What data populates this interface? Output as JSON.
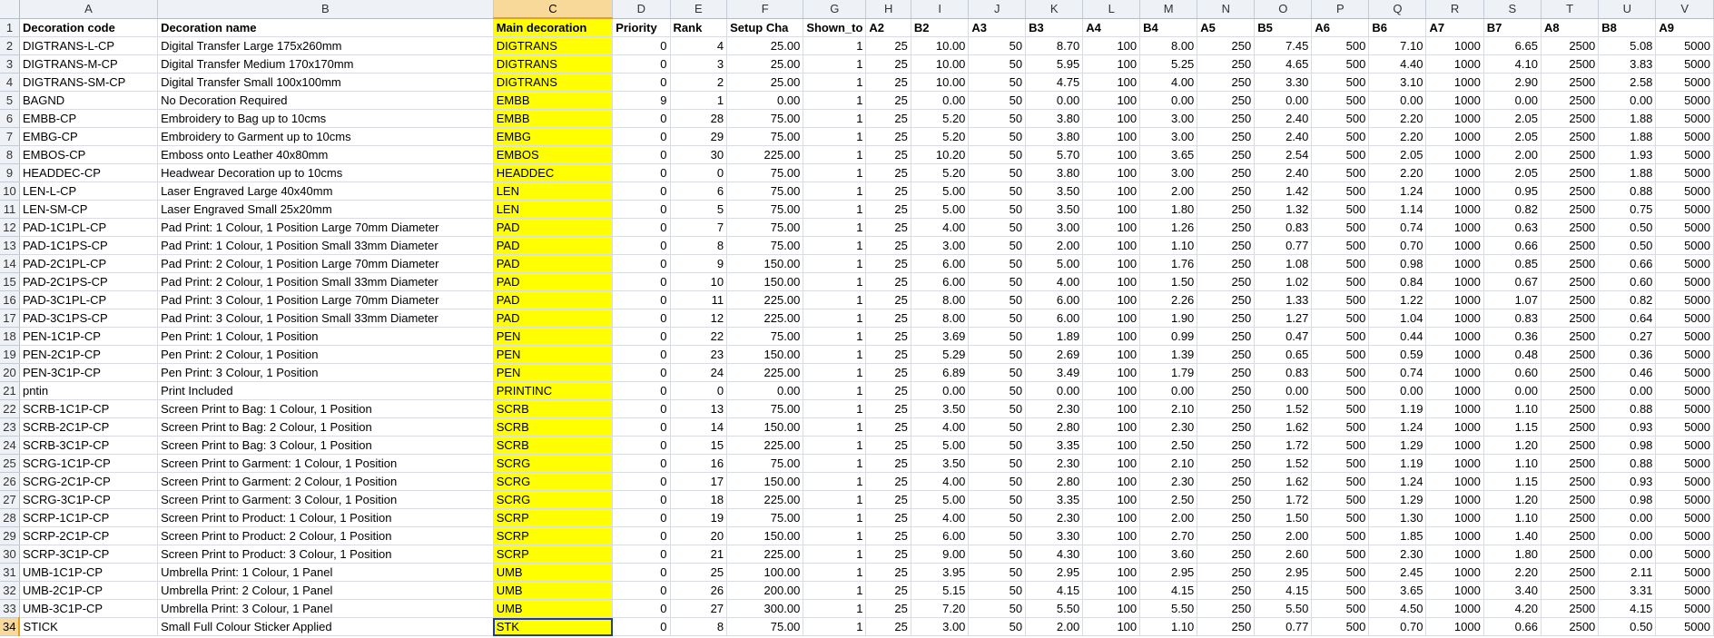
{
  "sheet": {
    "columns": [
      "A",
      "B",
      "C",
      "D",
      "E",
      "F",
      "G",
      "H",
      "I",
      "J",
      "K",
      "L",
      "M",
      "N",
      "O",
      "P",
      "Q",
      "R",
      "S",
      "T",
      "U",
      "V"
    ],
    "selected_column": "C",
    "selected_row": 34,
    "header_row": [
      "Decoration code",
      "Decoration name",
      "Main decoration",
      "Priority",
      "Rank",
      "Setup Cha",
      "Shown_to",
      "A2",
      "B2",
      "A3",
      "B3",
      "A4",
      "B4",
      "A5",
      "B5",
      "A6",
      "B6",
      "A7",
      "B7",
      "A8",
      "B8",
      "A9"
    ],
    "rows": [
      [
        "DIGTRANS-L-CP",
        "Digital Transfer Large 175x260mm",
        "DIGTRANS",
        "0",
        "4",
        "25.00",
        "1",
        "25",
        "10.00",
        "50",
        "8.70",
        "100",
        "8.00",
        "250",
        "7.45",
        "500",
        "7.10",
        "1000",
        "6.65",
        "2500",
        "5.08",
        "5000"
      ],
      [
        "DIGTRANS-M-CP",
        "Digital Transfer Medium 170x170mm",
        "DIGTRANS",
        "0",
        "3",
        "25.00",
        "1",
        "25",
        "10.00",
        "50",
        "5.95",
        "100",
        "5.25",
        "250",
        "4.65",
        "500",
        "4.40",
        "1000",
        "4.10",
        "2500",
        "3.83",
        "5000"
      ],
      [
        "DIGTRANS-SM-CP",
        "Digital Transfer Small 100x100mm",
        "DIGTRANS",
        "0",
        "2",
        "25.00",
        "1",
        "25",
        "10.00",
        "50",
        "4.75",
        "100",
        "4.00",
        "250",
        "3.30",
        "500",
        "3.10",
        "1000",
        "2.90",
        "2500",
        "2.58",
        "5000"
      ],
      [
        "BAGND",
        "No Decoration Required",
        "EMBB",
        "9",
        "1",
        "0.00",
        "1",
        "25",
        "0.00",
        "50",
        "0.00",
        "100",
        "0.00",
        "250",
        "0.00",
        "500",
        "0.00",
        "1000",
        "0.00",
        "2500",
        "0.00",
        "5000"
      ],
      [
        "EMBB-CP",
        "Embroidery to Bag up to 10cms",
        "EMBB",
        "0",
        "28",
        "75.00",
        "1",
        "25",
        "5.20",
        "50",
        "3.80",
        "100",
        "3.00",
        "250",
        "2.40",
        "500",
        "2.20",
        "1000",
        "2.05",
        "2500",
        "1.88",
        "5000"
      ],
      [
        "EMBG-CP",
        "Embroidery to Garment up to 10cms",
        "EMBG",
        "0",
        "29",
        "75.00",
        "1",
        "25",
        "5.20",
        "50",
        "3.80",
        "100",
        "3.00",
        "250",
        "2.40",
        "500",
        "2.20",
        "1000",
        "2.05",
        "2500",
        "1.88",
        "5000"
      ],
      [
        "EMBOS-CP",
        "Emboss onto Leather 40x80mm",
        "EMBOS",
        "0",
        "30",
        "225.00",
        "1",
        "25",
        "10.20",
        "50",
        "5.70",
        "100",
        "3.65",
        "250",
        "2.54",
        "500",
        "2.05",
        "1000",
        "2.00",
        "2500",
        "1.93",
        "5000"
      ],
      [
        "HEADDEC-CP",
        "Headwear Decoration up to 10cms",
        "HEADDEC",
        "0",
        "0",
        "75.00",
        "1",
        "25",
        "5.20",
        "50",
        "3.80",
        "100",
        "3.00",
        "250",
        "2.40",
        "500",
        "2.20",
        "1000",
        "2.05",
        "2500",
        "1.88",
        "5000"
      ],
      [
        "LEN-L-CP",
        "Laser Engraved Large 40x40mm",
        "LEN",
        "0",
        "6",
        "75.00",
        "1",
        "25",
        "5.00",
        "50",
        "3.50",
        "100",
        "2.00",
        "250",
        "1.42",
        "500",
        "1.24",
        "1000",
        "0.95",
        "2500",
        "0.88",
        "5000"
      ],
      [
        "LEN-SM-CP",
        "Laser Engraved Small 25x20mm",
        "LEN",
        "0",
        "5",
        "75.00",
        "1",
        "25",
        "5.00",
        "50",
        "3.50",
        "100",
        "1.80",
        "250",
        "1.32",
        "500",
        "1.14",
        "1000",
        "0.82",
        "2500",
        "0.75",
        "5000"
      ],
      [
        "PAD-1C1PL-CP",
        "Pad Print: 1 Colour, 1 Position Large 70mm Diameter",
        "PAD",
        "0",
        "7",
        "75.00",
        "1",
        "25",
        "4.00",
        "50",
        "3.00",
        "100",
        "1.26",
        "250",
        "0.83",
        "500",
        "0.74",
        "1000",
        "0.63",
        "2500",
        "0.50",
        "5000"
      ],
      [
        "PAD-1C1PS-CP",
        "Pad Print: 1 Colour, 1 Position Small 33mm Diameter",
        "PAD",
        "0",
        "8",
        "75.00",
        "1",
        "25",
        "3.00",
        "50",
        "2.00",
        "100",
        "1.10",
        "250",
        "0.77",
        "500",
        "0.70",
        "1000",
        "0.66",
        "2500",
        "0.50",
        "5000"
      ],
      [
        "PAD-2C1PL-CP",
        "Pad Print: 2 Colour, 1 Position Large 70mm Diameter",
        "PAD",
        "0",
        "9",
        "150.00",
        "1",
        "25",
        "6.00",
        "50",
        "5.00",
        "100",
        "1.76",
        "250",
        "1.08",
        "500",
        "0.98",
        "1000",
        "0.85",
        "2500",
        "0.66",
        "5000"
      ],
      [
        "PAD-2C1PS-CP",
        "Pad Print: 2 Colour, 1 Position Small 33mm Diameter",
        "PAD",
        "0",
        "10",
        "150.00",
        "1",
        "25",
        "6.00",
        "50",
        "4.00",
        "100",
        "1.50",
        "250",
        "1.02",
        "500",
        "0.84",
        "1000",
        "0.67",
        "2500",
        "0.60",
        "5000"
      ],
      [
        "PAD-3C1PL-CP",
        "Pad Print: 3 Colour, 1 Position Large 70mm Diameter",
        "PAD",
        "0",
        "11",
        "225.00",
        "1",
        "25",
        "8.00",
        "50",
        "6.00",
        "100",
        "2.26",
        "250",
        "1.33",
        "500",
        "1.22",
        "1000",
        "1.07",
        "2500",
        "0.82",
        "5000"
      ],
      [
        "PAD-3C1PS-CP",
        "Pad Print: 3 Colour, 1 Position Small 33mm Diameter",
        "PAD",
        "0",
        "12",
        "225.00",
        "1",
        "25",
        "8.00",
        "50",
        "6.00",
        "100",
        "1.90",
        "250",
        "1.27",
        "500",
        "1.04",
        "1000",
        "0.83",
        "2500",
        "0.64",
        "5000"
      ],
      [
        "PEN-1C1P-CP",
        "Pen Print: 1 Colour, 1 Position",
        "PEN",
        "0",
        "22",
        "75.00",
        "1",
        "25",
        "3.69",
        "50",
        "1.89",
        "100",
        "0.99",
        "250",
        "0.47",
        "500",
        "0.44",
        "1000",
        "0.36",
        "2500",
        "0.27",
        "5000"
      ],
      [
        "PEN-2C1P-CP",
        "Pen Print: 2 Colour, 1 Position",
        "PEN",
        "0",
        "23",
        "150.00",
        "1",
        "25",
        "5.29",
        "50",
        "2.69",
        "100",
        "1.39",
        "250",
        "0.65",
        "500",
        "0.59",
        "1000",
        "0.48",
        "2500",
        "0.36",
        "5000"
      ],
      [
        "PEN-3C1P-CP",
        "Pen Print: 3 Colour, 1 Position",
        "PEN",
        "0",
        "24",
        "225.00",
        "1",
        "25",
        "6.89",
        "50",
        "3.49",
        "100",
        "1.79",
        "250",
        "0.83",
        "500",
        "0.74",
        "1000",
        "0.60",
        "2500",
        "0.46",
        "5000"
      ],
      [
        "pntin",
        "Print Included",
        "PRINTINC",
        "0",
        "0",
        "0.00",
        "1",
        "25",
        "0.00",
        "50",
        "0.00",
        "100",
        "0.00",
        "250",
        "0.00",
        "500",
        "0.00",
        "1000",
        "0.00",
        "2500",
        "0.00",
        "5000"
      ],
      [
        "SCRB-1C1P-CP",
        "Screen Print to Bag: 1 Colour, 1 Position",
        "SCRB",
        "0",
        "13",
        "75.00",
        "1",
        "25",
        "3.50",
        "50",
        "2.30",
        "100",
        "2.10",
        "250",
        "1.52",
        "500",
        "1.19",
        "1000",
        "1.10",
        "2500",
        "0.88",
        "5000"
      ],
      [
        "SCRB-2C1P-CP",
        "Screen Print to Bag: 2 Colour, 1 Position",
        "SCRB",
        "0",
        "14",
        "150.00",
        "1",
        "25",
        "4.00",
        "50",
        "2.80",
        "100",
        "2.30",
        "250",
        "1.62",
        "500",
        "1.24",
        "1000",
        "1.15",
        "2500",
        "0.93",
        "5000"
      ],
      [
        "SCRB-3C1P-CP",
        "Screen Print to Bag: 3 Colour, 1 Position",
        "SCRB",
        "0",
        "15",
        "225.00",
        "1",
        "25",
        "5.00",
        "50",
        "3.35",
        "100",
        "2.50",
        "250",
        "1.72",
        "500",
        "1.29",
        "1000",
        "1.20",
        "2500",
        "0.98",
        "5000"
      ],
      [
        "SCRG-1C1P-CP",
        "Screen Print to Garment: 1 Colour, 1 Position",
        "SCRG",
        "0",
        "16",
        "75.00",
        "1",
        "25",
        "3.50",
        "50",
        "2.30",
        "100",
        "2.10",
        "250",
        "1.52",
        "500",
        "1.19",
        "1000",
        "1.10",
        "2500",
        "0.88",
        "5000"
      ],
      [
        "SCRG-2C1P-CP",
        "Screen Print to Garment: 2 Colour, 1 Position",
        "SCRG",
        "0",
        "17",
        "150.00",
        "1",
        "25",
        "4.00",
        "50",
        "2.80",
        "100",
        "2.30",
        "250",
        "1.62",
        "500",
        "1.24",
        "1000",
        "1.15",
        "2500",
        "0.93",
        "5000"
      ],
      [
        "SCRG-3C1P-CP",
        "Screen Print to Garment: 3 Colour, 1 Position",
        "SCRG",
        "0",
        "18",
        "225.00",
        "1",
        "25",
        "5.00",
        "50",
        "3.35",
        "100",
        "2.50",
        "250",
        "1.72",
        "500",
        "1.29",
        "1000",
        "1.20",
        "2500",
        "0.98",
        "5000"
      ],
      [
        "SCRP-1C1P-CP",
        "Screen Print to Product: 1 Colour, 1 Position",
        "SCRP",
        "0",
        "19",
        "75.00",
        "1",
        "25",
        "4.00",
        "50",
        "2.30",
        "100",
        "2.00",
        "250",
        "1.50",
        "500",
        "1.30",
        "1000",
        "1.10",
        "2500",
        "0.00",
        "5000"
      ],
      [
        "SCRP-2C1P-CP",
        "Screen Print to Product: 2 Colour, 1 Position",
        "SCRP",
        "0",
        "20",
        "150.00",
        "1",
        "25",
        "6.00",
        "50",
        "3.30",
        "100",
        "2.70",
        "250",
        "2.00",
        "500",
        "1.85",
        "1000",
        "1.40",
        "2500",
        "0.00",
        "5000"
      ],
      [
        "SCRP-3C1P-CP",
        "Screen Print to Product: 3 Colour, 1 Position",
        "SCRP",
        "0",
        "21",
        "225.00",
        "1",
        "25",
        "9.00",
        "50",
        "4.30",
        "100",
        "3.60",
        "250",
        "2.60",
        "500",
        "2.30",
        "1000",
        "1.80",
        "2500",
        "0.00",
        "5000"
      ],
      [
        "UMB-1C1P-CP",
        "Umbrella Print: 1 Colour, 1 Panel",
        "UMB",
        "0",
        "25",
        "100.00",
        "1",
        "25",
        "3.95",
        "50",
        "2.95",
        "100",
        "2.95",
        "250",
        "2.95",
        "500",
        "2.45",
        "1000",
        "2.20",
        "2500",
        "2.11",
        "5000"
      ],
      [
        "UMB-2C1P-CP",
        "Umbrella Print: 2 Colour, 1 Panel",
        "UMB",
        "0",
        "26",
        "200.00",
        "1",
        "25",
        "5.15",
        "50",
        "4.15",
        "100",
        "4.15",
        "250",
        "4.15",
        "500",
        "3.65",
        "1000",
        "3.40",
        "2500",
        "3.31",
        "5000"
      ],
      [
        "UMB-3C1P-CP",
        "Umbrella Print: 3 Colour, 1 Panel",
        "UMB",
        "0",
        "27",
        "300.00",
        "1",
        "25",
        "7.20",
        "50",
        "5.50",
        "100",
        "5.50",
        "250",
        "5.50",
        "500",
        "4.50",
        "1000",
        "4.20",
        "2500",
        "4.15",
        "5000"
      ],
      [
        "STICK",
        "Small Full Colour Sticker Applied",
        "STK",
        "0",
        "8",
        "75.00",
        "1",
        "25",
        "3.00",
        "50",
        "2.00",
        "100",
        "1.10",
        "250",
        "0.77",
        "500",
        "0.70",
        "1000",
        "0.66",
        "2500",
        "0.50",
        "5000"
      ]
    ],
    "highlight_color": "#ffff00",
    "selection_header_color": "#f9d99a"
  }
}
